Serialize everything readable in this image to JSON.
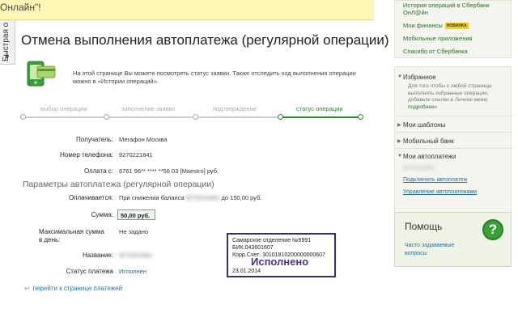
{
  "quick_tab": {
    "label": "Быстрая о",
    "arrow": "▼"
  },
  "banner": {
    "text": "Онлайн\"!"
  },
  "page": {
    "title": "Отмена выполнения автоплатежа (регулярной операции)",
    "intro": "На этой странице Вы можете посмотреть статус заявки. Также отследить ход выполнения операции можно в «Истории операций»."
  },
  "steps": [
    {
      "label": "выбор операции",
      "active": false
    },
    {
      "label": "заполнение заявки",
      "active": false
    },
    {
      "label": "подтверждение",
      "active": false
    },
    {
      "label": "статус операции",
      "active": true
    }
  ],
  "details": {
    "recipient_label": "Получатель:",
    "recipient_value": "Мегафон Москва",
    "phone_label": "Номер телефона:",
    "phone_value": "9270221841",
    "pay_from_label": "Оплата с:",
    "pay_from_value": "6761 96** **** **56 03  [Maestro]  руб."
  },
  "params": {
    "heading": "Параметры автоплатежа (регулярной операции)",
    "paid_label": "Оплачивается:",
    "paid_value_pre": "При снижении баланса",
    "paid_value_blur": "9270221841",
    "paid_value_post": "до  150,00  руб.",
    "sum_label": "Сумма:",
    "sum_value": "50,00  руб.",
    "max_label": "Максимальная сумма в день:",
    "max_value": "Не задано",
    "name_label": "Название:",
    "name_value_blur": "9270221841",
    "status_label": "Статус платежа",
    "status_value": "Исполнен"
  },
  "stamp": {
    "line1": "Самарское отделение №6991",
    "line2": "БИК:043601607",
    "line3": "Корр.Счет: 30101810200000000607",
    "big": "Исполнено",
    "date": "23.01.2014"
  },
  "back_link": "перейти к странице платежей",
  "sidebar": {
    "top_links": [
      "История операций в Сбербанк ОнЛ@йн",
      "Мои финансы",
      "Мобильные приложения",
      "Спасибо от Сбербанка"
    ],
    "badge": "НОВИНКА",
    "favorites_head": "Избранное",
    "favorites_text_pre": "Для того чтобы с любой страницы выполнять избранные операции, добавьте ссылки в Личное меню",
    "favorites_text_link": "подробнее»",
    "templates_head": "Мои шаблоны",
    "mobile_bank_head": "Мобильный банк",
    "autopay_head": "Мои автоплатежи",
    "autopay_blur": "9270221841",
    "autopay_connect": "Подключить автоплатеж",
    "autopay_manage": "Управление автоплатежами",
    "toggle": "▶",
    "toggle_open": "▼"
  },
  "help": {
    "title": "Помощь",
    "link": "Часто задаваемые вопросы",
    "icon": "?"
  },
  "colors": {
    "banner": "#fdf6b4",
    "accent_green": "#2b8c2b",
    "link_blue": "#1f5fa8",
    "stamp_purple": "#4a3389",
    "badge_yellow": "#f5d21a"
  }
}
